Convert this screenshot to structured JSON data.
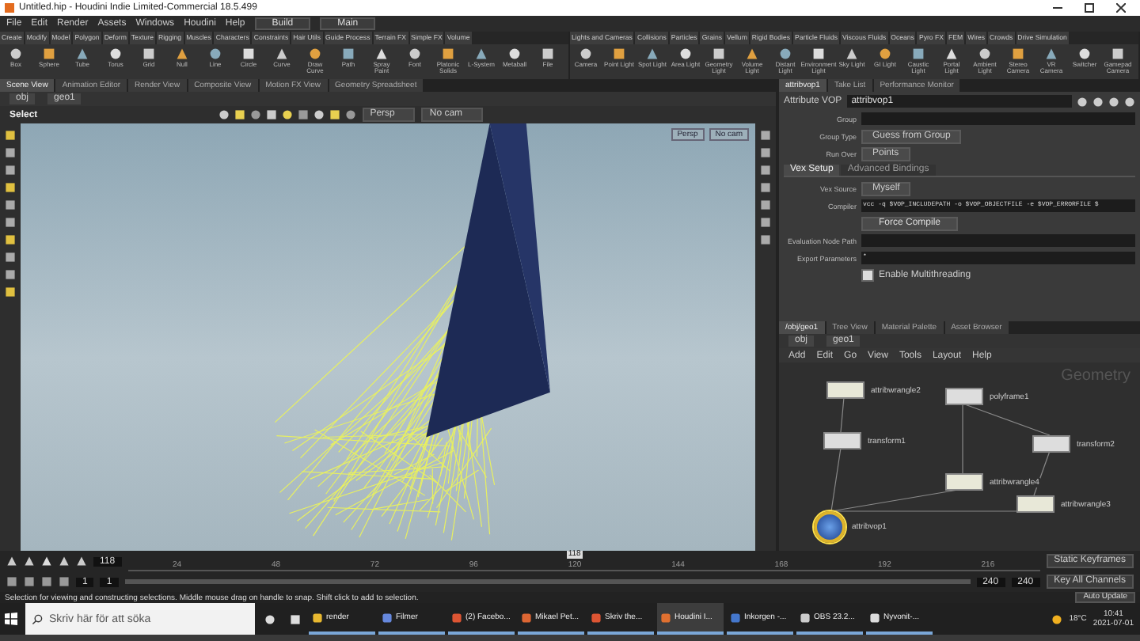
{
  "window": {
    "title": "Untitled.hip - Houdini Indie Limited-Commercial 18.5.499"
  },
  "menu": [
    "File",
    "Edit",
    "Render",
    "Assets",
    "Windows",
    "Houdini",
    "Help"
  ],
  "desktops": [
    "Build",
    "Main"
  ],
  "shelf_tabs_left": [
    "Create",
    "Modify",
    "Model",
    "Polygon",
    "Deform",
    "Texture",
    "Rigging",
    "Muscles",
    "Characters",
    "Constraints",
    "Hair Utils",
    "Guide Process",
    "Terrain FX",
    "Simple FX",
    "Volume"
  ],
  "shelf_tools_left": [
    "Box",
    "Sphere",
    "Tube",
    "Torus",
    "Grid",
    "Null",
    "Line",
    "Circle",
    "Curve",
    "Draw Curve",
    "Path",
    "Spray Paint",
    "Font",
    "Platonic Solids",
    "L-System",
    "Metaball",
    "File"
  ],
  "shelf_tabs_right": [
    "Lights and Cameras",
    "Collisions",
    "Particles",
    "Grains",
    "Vellum",
    "Rigid Bodies",
    "Particle Fluids",
    "Viscous Fluids",
    "Oceans",
    "Pyro FX",
    "FEM",
    "Wires",
    "Crowds",
    "Drive Simulation"
  ],
  "shelf_tools_right": [
    "Camera",
    "Point Light",
    "Spot Light",
    "Area Light",
    "Geometry Light",
    "Volume Light",
    "Distant Light",
    "Environment Light",
    "Sky Light",
    "GI Light",
    "Caustic Light",
    "Portal Light",
    "Ambient Light",
    "Stereo Camera",
    "VR Camera",
    "Switcher",
    "Gamepad Camera"
  ],
  "pane_tabs_left": [
    {
      "label": "Scene View",
      "selected": true
    },
    {
      "label": "Animation Editor",
      "selected": false
    },
    {
      "label": "Render View",
      "selected": false
    },
    {
      "label": "Composite View",
      "selected": false
    },
    {
      "label": "Motion FX View",
      "selected": false
    },
    {
      "label": "Geometry Spreadsheet",
      "selected": false
    }
  ],
  "pane_tabs_right": [
    {
      "label": "attribvop1",
      "selected": true
    },
    {
      "label": "Take List",
      "selected": false
    },
    {
      "label": "Performance Monitor",
      "selected": false
    }
  ],
  "viewport": {
    "path": [
      "obj",
      "geo1"
    ],
    "tool": "Select",
    "camera": "Persp",
    "camera_menu": "No cam",
    "display": [
      "Persp",
      "No cam"
    ]
  },
  "parameters": {
    "node_type": "Attribute VOP",
    "node_name": "attribvop1",
    "rows": [
      {
        "kind": "text",
        "label": "Group",
        "value": ""
      },
      {
        "kind": "menu",
        "label": "Group Type",
        "value": "Guess from Group"
      },
      {
        "kind": "menu",
        "label": "Run Over",
        "value": "Points"
      }
    ],
    "tabs": [
      {
        "label": "Vex Setup",
        "selected": true
      },
      {
        "label": "Advanced Bindings",
        "selected": false
      }
    ],
    "tab_rows": [
      {
        "kind": "menu",
        "label": "Vex Source",
        "value": "Myself"
      },
      {
        "kind": "text",
        "label": "Compiler",
        "value": "vcc -q $VOP_INCLUDEPATH -o $VOP_OBJECTFILE -e $VOP_ERRORFILE $"
      },
      {
        "kind": "button",
        "label": "",
        "value": "Force Compile"
      },
      {
        "kind": "text",
        "label": "Evaluation Node Path",
        "value": ""
      },
      {
        "kind": "text",
        "label": "Export Parameters",
        "value": "*"
      },
      {
        "kind": "checkbox",
        "label": "",
        "value": "Enable Multithreading",
        "checked": true
      }
    ]
  },
  "network": {
    "tabs": [
      {
        "label": "/obj/geo1",
        "selected": true
      },
      {
        "label": "Tree View",
        "selected": false
      },
      {
        "label": "Material Palette",
        "selected": false
      },
      {
        "label": "Asset Browser",
        "selected": false
      }
    ],
    "path": [
      "obj",
      "geo1"
    ],
    "menu": [
      "Add",
      "Edit",
      "Go",
      "View",
      "Tools",
      "Layout",
      "Help"
    ],
    "context": "Geometry",
    "nodes": [
      {
        "name": "attribwrangle2",
        "kind": "wrangle",
        "selected": false
      },
      {
        "name": "polyframe1",
        "kind": "sop",
        "selected": false
      },
      {
        "name": "transform1",
        "kind": "sop",
        "selected": false
      },
      {
        "name": "transform2",
        "kind": "sop",
        "selected": false
      },
      {
        "name": "attribwrangle4",
        "kind": "wrangle",
        "selected": false
      },
      {
        "name": "attribwrangle3",
        "kind": "wrangle",
        "selected": false
      },
      {
        "name": "attribvop1",
        "kind": "vop",
        "selected": true
      }
    ]
  },
  "timeline": {
    "frame": "118",
    "marker": "118",
    "level": 0.49,
    "ticks": [
      "24",
      "48",
      "72",
      "96",
      "120",
      "144",
      "168",
      "192",
      "216"
    ],
    "range": [
      "1",
      "1",
      "240",
      "240"
    ],
    "buttons": [
      "Static Keyframes",
      "Key All Channels"
    ],
    "update": "Auto Update"
  },
  "status": "Selection for viewing and constructing selections. Middle mouse drag on handle to snap. Shift click to add to selection.",
  "taskbar": {
    "search": "Skriv här för att söka",
    "apps": [
      {
        "label": "render",
        "selected": false
      },
      {
        "label": "Filmer",
        "selected": false
      },
      {
        "label": "(2) Facebo...",
        "selected": false
      },
      {
        "label": "Mikael Pet...",
        "selected": false
      },
      {
        "label": "Skriv the...",
        "selected": false
      },
      {
        "label": "Houdini I...",
        "selected": true
      },
      {
        "label": "Inkorgen -...",
        "selected": false
      },
      {
        "label": "OBS 23.2...",
        "selected": false
      },
      {
        "label": "Nyvonit-...",
        "selected": false
      }
    ],
    "weather": "18°C",
    "time": "10:41",
    "date": "2021-07-01"
  }
}
